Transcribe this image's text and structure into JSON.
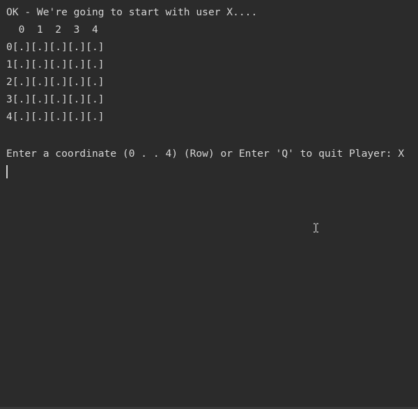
{
  "console": {
    "lines": [
      "OK - We're going to start with user X....",
      "  0  1  2  3  4",
      "0[.][.][.][.][.]",
      "1[.][.][.][.][.]",
      "2[.][.][.][.][.]",
      "3[.][.][.][.][.]",
      "4[.][.][.][.][.]",
      "",
      "Enter a coordinate (0 . . 4) (Row) or Enter 'Q' to quit Player: X"
    ],
    "input_value": ""
  },
  "colors": {
    "background": "#2b2b2b",
    "text": "#d6d6d6"
  },
  "icons": {
    "mouse_pointer": "i-beam-cursor-icon"
  }
}
